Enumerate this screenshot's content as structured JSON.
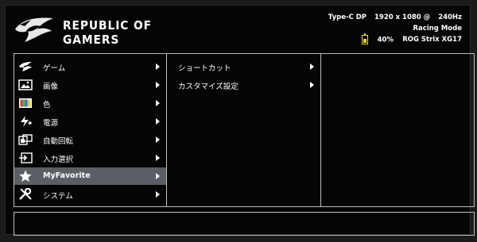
{
  "header": {
    "brand_line1": "REPUBLIC OF",
    "brand_line2": "GAMERS",
    "logo_icon": "rog-eye-icon"
  },
  "status": {
    "input": "Type-C DP",
    "resolution": "1920 x 1080 @",
    "refresh": "240Hz",
    "mode": "Racing Mode",
    "battery_icon": "battery-icon",
    "battery_percent": "40%",
    "model": "ROG Strix XG17"
  },
  "main_menu": [
    {
      "label": "ゲーム",
      "icon": "rog-eye-icon"
    },
    {
      "label": "画像",
      "icon": "image-icon"
    },
    {
      "label": "色",
      "icon": "color-bars-icon"
    },
    {
      "label": "電源",
      "icon": "power-bolt-icon"
    },
    {
      "label": "自動回転",
      "icon": "auto-rotate-icon"
    },
    {
      "label": "入力選択",
      "icon": "input-select-icon"
    },
    {
      "label": "MyFavorite",
      "icon": "star-icon",
      "selected": true
    },
    {
      "label": "システム",
      "icon": "wrench-icon"
    }
  ],
  "submenu": [
    {
      "label": "ショートカット"
    },
    {
      "label": "カスタマイズ設定"
    }
  ],
  "colors": {
    "selected_bg": "#5b5e64",
    "border": "#bdbdbd",
    "battery": "#e8d23a"
  }
}
